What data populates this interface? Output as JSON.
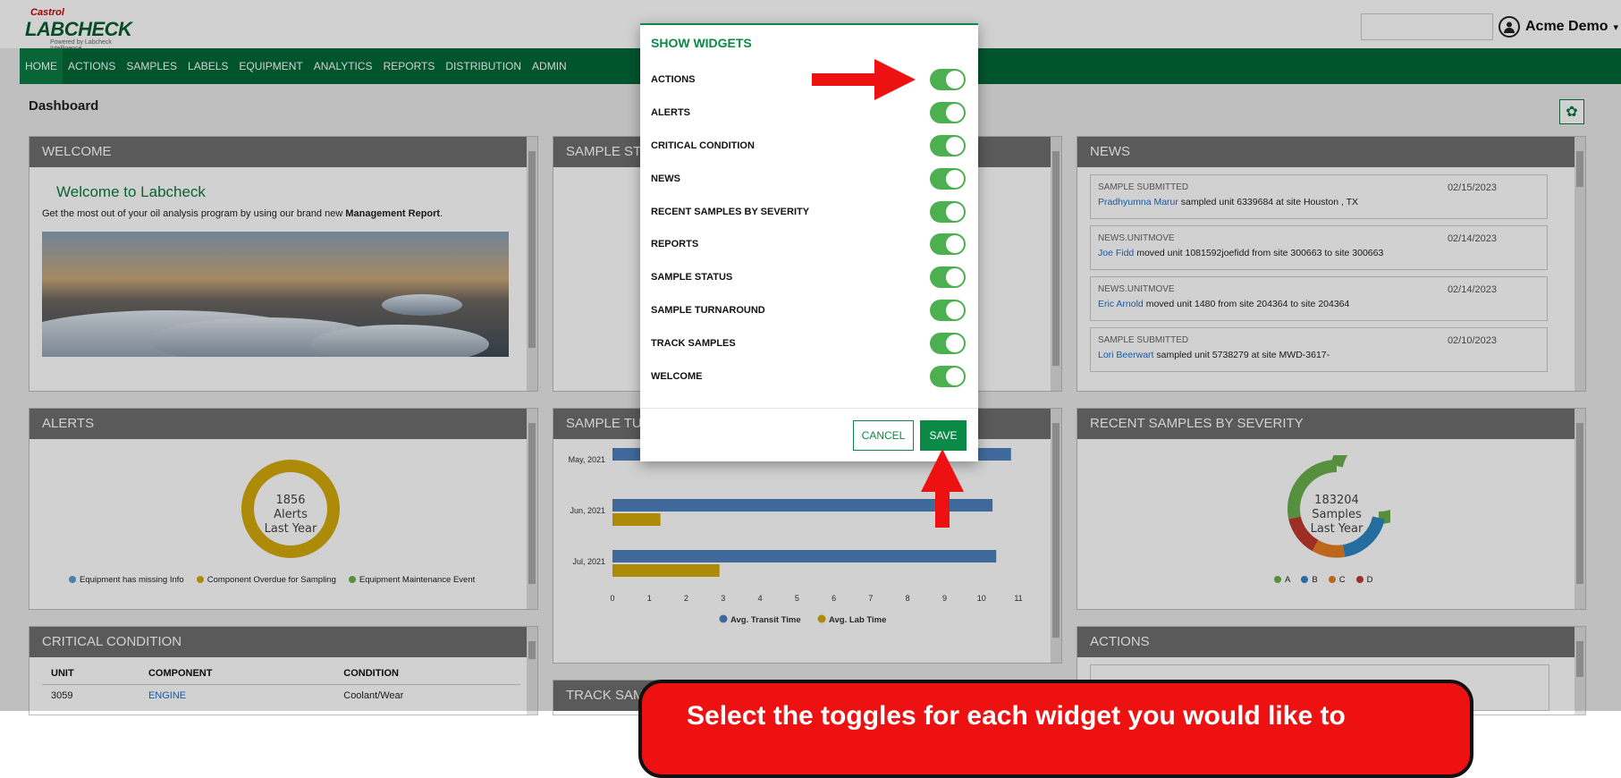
{
  "header": {
    "brand_top": "Castrol",
    "brand_main": "LABCHECK",
    "brand_sub": "Powered by Labcheck Intelligence",
    "user_name": "Acme Demo"
  },
  "nav": {
    "items": [
      "HOME",
      "ACTIONS",
      "SAMPLES",
      "LABELS",
      "EQUIPMENT",
      "ANALYTICS",
      "REPORTS",
      "DISTRIBUTION",
      "ADMIN"
    ],
    "active": "HOME"
  },
  "page": {
    "title": "Dashboard"
  },
  "widgets": {
    "welcome": {
      "title": "WELCOME",
      "heading": "Welcome to Labcheck",
      "text_prefix": "Get the most out of your oil analysis program by using our brand new ",
      "text_bold": "Management Report",
      "text_suffix": "."
    },
    "sample_status": {
      "title": "SAMPLE STATUS"
    },
    "news": {
      "title": "NEWS",
      "items": [
        {
          "type": "SAMPLE SUBMITTED",
          "date": "02/15/2023",
          "user": "Pradhyumna Marur",
          "text": " sampled unit 6339684 at site Houston , TX"
        },
        {
          "type": "NEWS.UNITMOVE",
          "date": "02/14/2023",
          "user": "Joe Fidd",
          "text": " moved unit 1081592joefidd from site 300663 to site 300663"
        },
        {
          "type": "NEWS.UNITMOVE",
          "date": "02/14/2023",
          "user": "Eric Arnold",
          "text": " moved unit 1480 from site 204364 to site 204364"
        },
        {
          "type": "SAMPLE SUBMITTED",
          "date": "02/10/2023",
          "user": "Lori Beerwart",
          "text": " sampled unit 5738279 at site MWD-3617-"
        }
      ]
    },
    "alerts": {
      "title": "ALERTS",
      "center_value": "1856",
      "center_line2": "Alerts",
      "center_line3": "Last Year",
      "legend": [
        {
          "label": "Equipment has missing Info",
          "color": "#5b9bd5"
        },
        {
          "label": "Component Overdue for Sampling",
          "color": "#d4a90a"
        },
        {
          "label": "Equipment Maintenance Event",
          "color": "#6ab04c"
        }
      ]
    },
    "sample_turnaround": {
      "title": "SAMPLE TURNAROUND"
    },
    "recent_samples": {
      "title": "RECENT SAMPLES BY SEVERITY",
      "center_value": "183204",
      "center_line2": "Samples",
      "center_line3": "Last Year",
      "legend": [
        {
          "label": "A",
          "color": "#6ab04c"
        },
        {
          "label": "B",
          "color": "#2e86c1"
        },
        {
          "label": "C",
          "color": "#e67e22"
        },
        {
          "label": "D",
          "color": "#c0392b"
        }
      ]
    },
    "critical": {
      "title": "CRITICAL CONDITION",
      "columns": [
        "UNIT",
        "COMPONENT",
        "CONDITION"
      ],
      "rows": [
        [
          "3059",
          "ENGINE",
          "Coolant/Wear"
        ]
      ]
    },
    "actions": {
      "title": "ACTIONS"
    },
    "track_samples": {
      "title": "TRACK SAMPLES"
    }
  },
  "chart_data": {
    "type": "bar",
    "orientation": "horizontal",
    "categories": [
      "May, 2021",
      "Jun, 2021",
      "Jul, 2021"
    ],
    "series": [
      {
        "name": "Avg. Transit Time",
        "color": "#4f81bd",
        "values": [
          10.8,
          10.3,
          10.4
        ]
      },
      {
        "name": "Avg. Lab Time",
        "color": "#d4a90a",
        "values": [
          0,
          1.3,
          2.9
        ]
      }
    ],
    "xlim": [
      0,
      11
    ],
    "xticks": [
      "0",
      "1",
      "2",
      "3",
      "4",
      "5",
      "6",
      "7",
      "8",
      "9",
      "10",
      "11"
    ],
    "legend_position": "bottom"
  },
  "modal": {
    "title": "SHOW WIDGETS",
    "toggles": [
      {
        "label": "ACTIONS",
        "on": true
      },
      {
        "label": "ALERTS",
        "on": true
      },
      {
        "label": "CRITICAL CONDITION",
        "on": true
      },
      {
        "label": "NEWS",
        "on": true
      },
      {
        "label": "RECENT SAMPLES BY SEVERITY",
        "on": true
      },
      {
        "label": "REPORTS",
        "on": true
      },
      {
        "label": "SAMPLE STATUS",
        "on": true
      },
      {
        "label": "SAMPLE TURNAROUND",
        "on": true
      },
      {
        "label": "TRACK SAMPLES",
        "on": true
      },
      {
        "label": "WELCOME",
        "on": true
      }
    ],
    "cancel_label": "CANCEL",
    "save_label": "SAVE"
  },
  "annotation": {
    "callout_text": "Select the toggles for each widget you would like to",
    "arrow_color": "#ee1111"
  }
}
